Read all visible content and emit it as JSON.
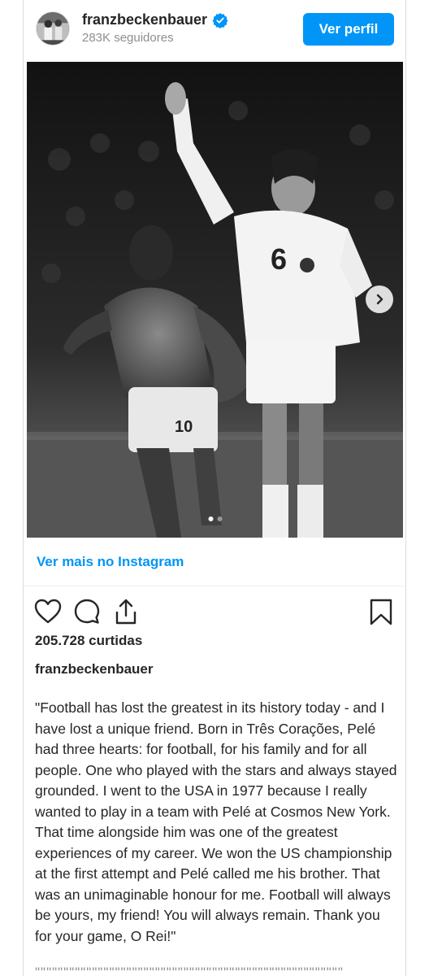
{
  "post": {
    "username": "franzbeckenbauer",
    "followers": "283K seguidores",
    "view_profile_label": "Ver perfil",
    "more_link": "Ver mais no Instagram",
    "likes": "205.728 curtidas",
    "caption_user": "franzbeckenbauer",
    "caption": "\"Football has lost the greatest in its history today - and I have lost a unique friend. Born in Três Corações, Pelé had three hearts: for football, for his family and for all people. One who played with the stars and always stayed grounded. I went to the USA in 1977 because I really wanted to play in a team with Pelé at Cosmos New York. That time alongside him was one of the greatest experiences of my career. We won the US championship at the first attempt and Pelé called me his brother. That was an unimaginable honour for me. Football will always be yours, my friend! You will always remain. Thank you for your game, O Rei!\"",
    "truncated_line": "\"\"\"\"\"\"\"\"\"\"\"\"\"\"\"\"\"\"\"\"\"\"\"\"\"\"\"\"\"\"\"\"\"\"\"\"\"\"\"\"\"\"\"\"\"\"\"\"\"\"\"\"\"\"",
    "jersey_left": "10",
    "jersey_right": "6",
    "carousel": {
      "total": 2,
      "active": 1
    }
  },
  "icons": {
    "verified": "verified-badge-icon",
    "next": "chevron-right-icon",
    "like": "heart-icon",
    "comment": "comment-icon",
    "share": "share-icon",
    "save": "bookmark-icon"
  },
  "colors": {
    "accent": "#0095f6",
    "text": "#262626",
    "muted": "#8e8e8e"
  }
}
